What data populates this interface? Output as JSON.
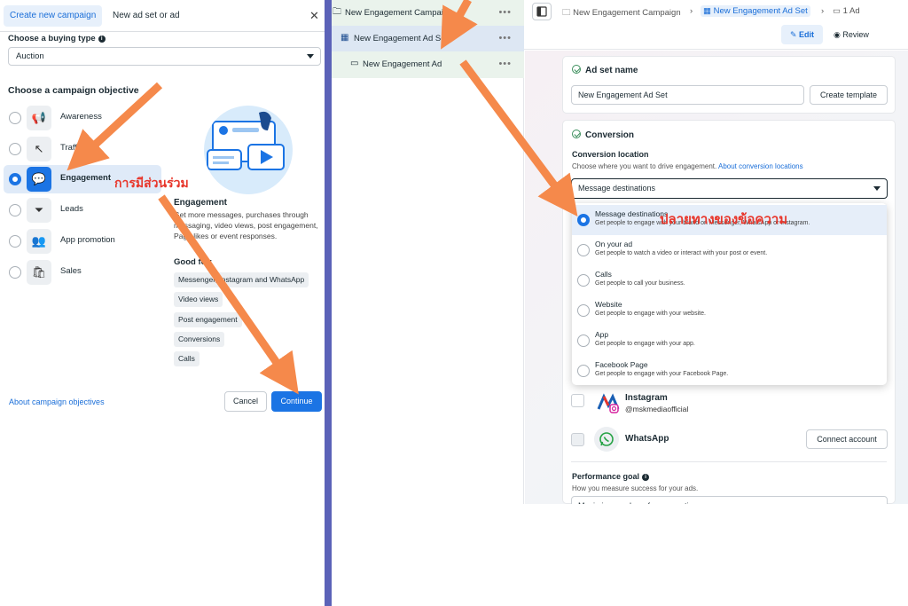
{
  "left_panel": {
    "tabs": [
      "Create new campaign",
      "New ad set or ad"
    ],
    "close_icon": "close-icon",
    "buying_type_label": "Choose a buying type",
    "buying_type_value": "Auction",
    "objective_title": "Choose a campaign objective",
    "objectives": [
      {
        "label": "Awareness",
        "icon": "megaphone-icon"
      },
      {
        "label": "Traffic",
        "icon": "cursor-icon"
      },
      {
        "label": "Engagement",
        "icon": "chat-bubbles-icon",
        "selected": true
      },
      {
        "label": "Leads",
        "icon": "funnel-icon"
      },
      {
        "label": "App promotion",
        "icon": "people-icon"
      },
      {
        "label": "Sales",
        "icon": "shopping-bag-icon"
      }
    ],
    "detail_title": "Engagement",
    "detail_description": "Get more messages, purchases through messaging, video views, post engagement, Page likes or event responses.",
    "good_for_label": "Good for:",
    "good_for_chips": [
      "Messenger, Instagram and WhatsApp",
      "Video views",
      "Post engagement",
      "Conversions",
      "Calls"
    ],
    "about_link": "About campaign objectives",
    "cancel_label": "Cancel",
    "continue_label": "Continue"
  },
  "tree": {
    "items": [
      {
        "label": "New Engagement Campaign",
        "icon": "folder-icon"
      },
      {
        "label": "New Engagement Ad Set",
        "icon": "grid-icon",
        "selected": true
      },
      {
        "label": "New Engagement Ad",
        "icon": "ad-icon"
      }
    ],
    "more_label": "•••"
  },
  "topbar": {
    "breadcrumbs": [
      "New Engagement Campaign",
      "New Engagement Ad Set",
      "1 Ad"
    ],
    "edit_label": "Edit",
    "review_label": "Review"
  },
  "adset": {
    "name_title": "Ad set name",
    "name_value": "New Engagement Ad Set",
    "create_template_label": "Create template"
  },
  "conversion": {
    "title": "Conversion",
    "location_label": "Conversion location",
    "location_desc": "Choose where you want to drive engagement.",
    "location_link": "About conversion locations",
    "selected_value": "Message destinations",
    "options": [
      {
        "title": "Message destinations",
        "desc": "Get people to engage with your brand on Messenger, WhatsApp or Instagram.",
        "selected": true
      },
      {
        "title": "On your ad",
        "desc": "Get people to watch a video or interact with your post or event."
      },
      {
        "title": "Calls",
        "desc": "Get people to call your business."
      },
      {
        "title": "Website",
        "desc": "Get people to engage with your website."
      },
      {
        "title": "App",
        "desc": "Get people to engage with your app."
      },
      {
        "title": "Facebook Page",
        "desc": "Get people to engage with your Facebook Page."
      }
    ],
    "instagram_label": "Instagram",
    "instagram_handle": "@mskmediaofficial",
    "whatsapp_label": "WhatsApp",
    "connect_label": "Connect account"
  },
  "performance": {
    "goal_label": "Performance goal",
    "goal_desc": "How you measure success for your ads.",
    "goal_value": "Maximize number of conversations"
  },
  "annotations": {
    "engagement_thai": "การมีส่วนร่วม",
    "message_dest_thai": "ปลายทางของข้อความ",
    "arrow_color": "#f5894b",
    "text_color": "#e8362b"
  }
}
